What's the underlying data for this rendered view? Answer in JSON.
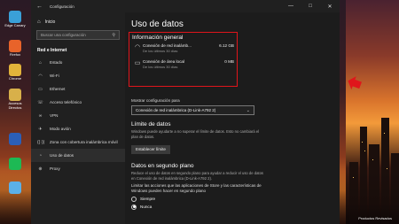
{
  "desktop": {
    "icons": [
      {
        "label": "Edge Canary",
        "color": "#3aa0d8"
      },
      {
        "label": "Firefox",
        "color": "#e8632a"
      },
      {
        "label": "Chrome",
        "color": "#e2b33a"
      },
      {
        "label": "Accesos Directos",
        "color": "#d8b04a"
      },
      {
        "label": "",
        "color": "#2b5fb8"
      },
      {
        "label": "",
        "color": "#1db954"
      },
      {
        "label": "",
        "color": "#5bb0e8"
      }
    ],
    "corner_label": "Productos Revisados"
  },
  "window": {
    "title": "Configuración",
    "back_icon": "back-arrow-icon",
    "controls": [
      "—",
      "□",
      "✕"
    ]
  },
  "sidebar": {
    "home_label": "Inicio",
    "search_placeholder": "Buscar una configuración",
    "section": "Red e Internet",
    "items": [
      {
        "label": "Estado",
        "icon": "⌂"
      },
      {
        "label": "Wi-Fi",
        "icon": "◠"
      },
      {
        "label": "Ethernet",
        "icon": "▭"
      },
      {
        "label": "Acceso telefónico",
        "icon": "☏"
      },
      {
        "label": "VPN",
        "icon": "∞"
      },
      {
        "label": "Modo avión",
        "icon": "✈"
      },
      {
        "label": "Zona con cobertura inalámbrica móvil",
        "icon": "((·))"
      },
      {
        "label": "Uso de datos",
        "icon": "◔"
      },
      {
        "label": "Proxy",
        "icon": "⊕"
      }
    ],
    "selected_index": 7
  },
  "main": {
    "title": "Uso de datos",
    "overview": {
      "heading": "Información general",
      "rows": [
        {
          "name": "Conexión de red inalámb...",
          "sub": "De los últimos 30 días",
          "value": "6.12 GB",
          "icon": "wifi-icon"
        },
        {
          "name": "Conexión de área local",
          "sub": "De los últimos 30 días",
          "value": "0 MB",
          "icon": "ethernet-icon"
        }
      ]
    },
    "show_settings_label": "Mostrar configuración para",
    "dropdown_value": "Conexión de red inalámbrica (D-Link-A792 2)",
    "limit_heading": "Límite de datos",
    "limit_text": "Windows puede ayudarte a no superar el límite de datos. Esto no cambiará el plan de datos.",
    "limit_button": "Establecer límite",
    "bg_heading": "Datos en segundo plano",
    "bg_text": "Reduce el uso de datos en segundo plano para ayudar a reducir el uso de datos en Conexión de red inalámbrica (D-Link-A792 2).",
    "bg_question": "Limitar las acciones que las aplicaciones de Store y las características de Windows pueden hacer en segundo plano",
    "radio_options": [
      {
        "label": "Siempre",
        "selected": false
      },
      {
        "label": "Nunca",
        "selected": true
      }
    ]
  },
  "annotation": {
    "box_color": "#e0151b",
    "arrow_color": "#e0151b"
  }
}
